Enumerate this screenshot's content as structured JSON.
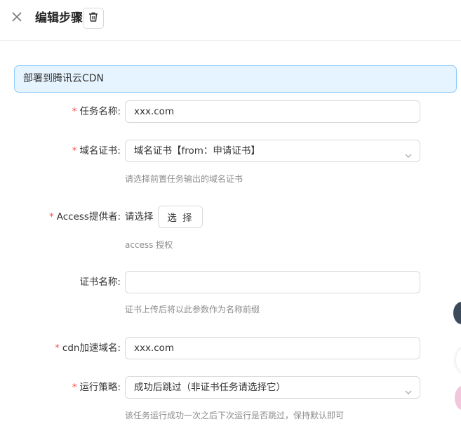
{
  "header": {
    "title": "编辑步骤"
  },
  "alert": {
    "text": "部署到腾讯云CDN"
  },
  "form": {
    "task_name": {
      "label": "任务名称:",
      "value": "xxx.com"
    },
    "domain_cert": {
      "label": "域名证书:",
      "value": "域名证书【from：申请证书】",
      "help": "请选择前置任务输出的域名证书"
    },
    "access_provider": {
      "label": "Access提供者:",
      "value": "请选择",
      "button": "选 择",
      "help": "access 授权"
    },
    "cert_name": {
      "label": "证书名称:",
      "value": "",
      "help": "证书上传后将以此参数作为名称前缀"
    },
    "cdn_domain": {
      "label": "cdn加速域名:",
      "value": "xxx.com"
    },
    "run_strategy": {
      "label": "运行策略:",
      "value": "成功后跳过（非证书任务请选择它）",
      "help": "该任务运行成功一次之后下次运行是否跳过，保持默认即可"
    }
  },
  "colors": {
    "required": "#ff4d4f",
    "alert_bg": "#e6f4ff",
    "alert_border": "#91caff"
  }
}
